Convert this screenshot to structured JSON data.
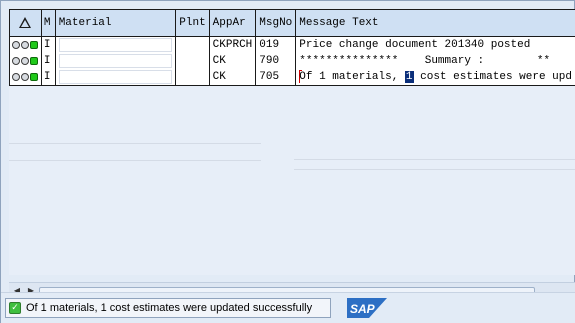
{
  "table": {
    "columns": {
      "status": "",
      "m": "M",
      "material": "Material",
      "plant": "Plnt",
      "application_area": "AppAr",
      "message_number": "MsgNo",
      "message_text": "Message Text"
    },
    "rows": [
      {
        "m": "I",
        "material": "",
        "plant": "",
        "application_area": "CKPRCH",
        "message_number": "019",
        "message_text": "Price change document 201340 posted"
      },
      {
        "m": "I",
        "material": "",
        "plant": "",
        "application_area": "CK",
        "message_number": "790",
        "message_text": "***************    Summary :        **"
      },
      {
        "m": "I",
        "material": "",
        "plant": "",
        "application_area": "CK",
        "message_number": "705",
        "message_text_before": "Of 1 materials, ",
        "message_text_selected": "1",
        "message_text_after": " cost estimates were upd"
      }
    ]
  },
  "status_bar": {
    "message": "Of 1 materials, 1 cost estimates were updated successfully",
    "logo_text": "SAP"
  },
  "colors": {
    "header_bg": "#cfe0f3",
    "frame_bg": "#e2ebf6",
    "selection_bg": "#0b2f7a",
    "success_green": "#3fbf3f",
    "sap_logo_blue": "#2d6fc4"
  }
}
